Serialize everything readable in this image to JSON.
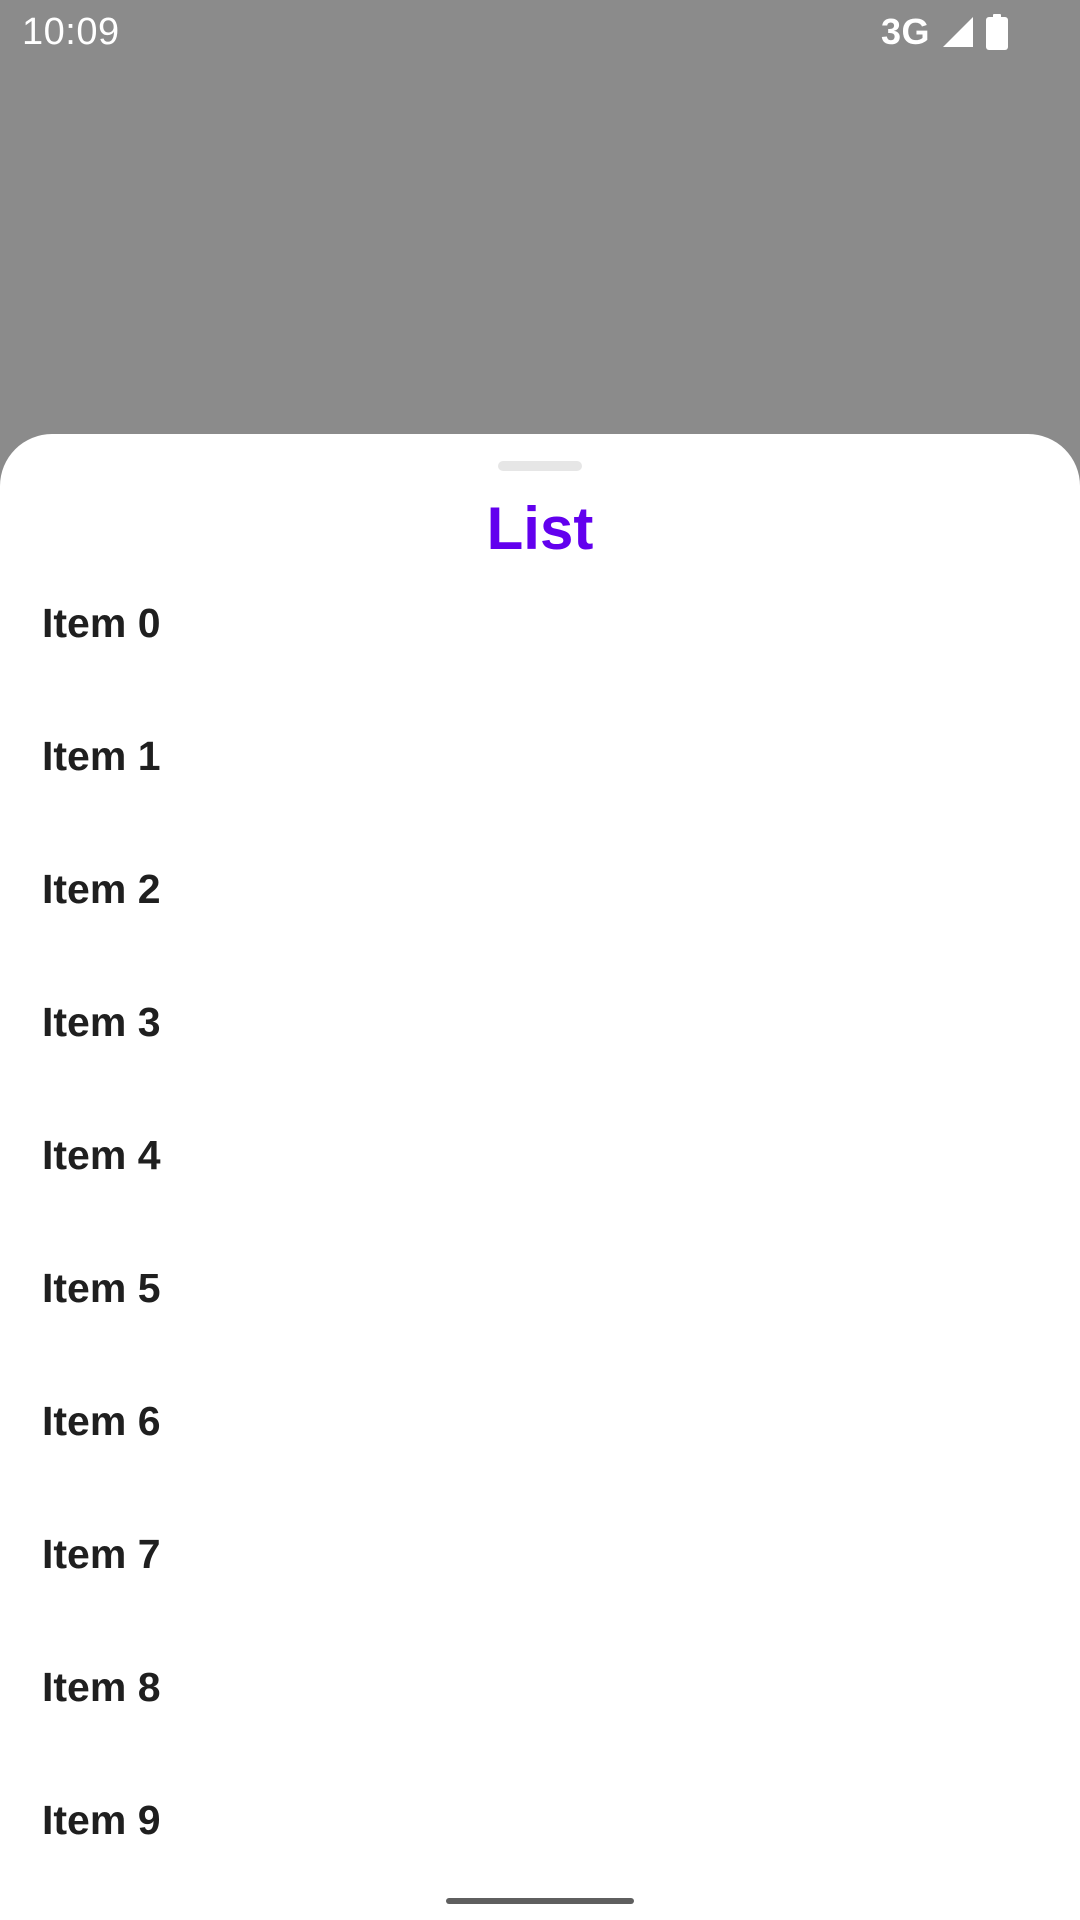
{
  "status_bar": {
    "time": "10:09",
    "network": "3G",
    "signal_icon": "cellular-signal-icon",
    "battery_icon": "battery-full-icon"
  },
  "sheet": {
    "title": "List",
    "title_color": "#6200ee",
    "items": [
      {
        "label": "Item 0"
      },
      {
        "label": "Item 1"
      },
      {
        "label": "Item 2"
      },
      {
        "label": "Item 3"
      },
      {
        "label": "Item 4"
      },
      {
        "label": "Item 5"
      },
      {
        "label": "Item 6"
      },
      {
        "label": "Item 7"
      },
      {
        "label": "Item 8"
      },
      {
        "label": "Item 9"
      }
    ]
  },
  "colors": {
    "scrim": "#8b8b8b",
    "sheet_background": "#ffffff",
    "item_text": "#1f1f1f"
  }
}
